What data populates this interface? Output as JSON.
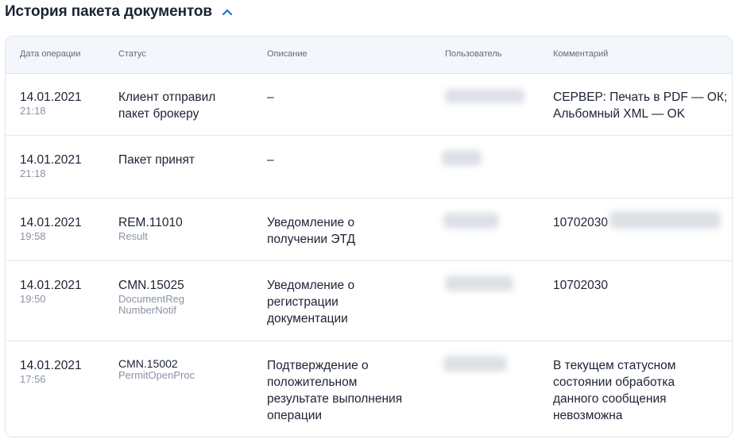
{
  "section": {
    "title": "История пакета документов",
    "expanded_icon": "chevron-up-icon"
  },
  "table": {
    "headers": [
      "Дата операции",
      "Статус",
      "Описание",
      "Пользователь",
      "Комментарий"
    ],
    "rows": [
      {
        "date": "14.01.2021",
        "time": "21:18",
        "status_main": "Клиент отправил пакет брокеру",
        "status_sub": "",
        "description": "–",
        "user": "",
        "comment": "СЕРВЕР: Печать в PDF — ОК; Альбомный XML — OK"
      },
      {
        "date": "14.01.2021",
        "time": "21:18",
        "status_main": "Пакет принят",
        "status_sub": "",
        "description": "–",
        "user": "",
        "comment": ""
      },
      {
        "date": "14.01.2021",
        "time": "19:58",
        "status_main": "REM.11010",
        "status_sub": "Result",
        "description": "Уведомление о получении ЭТД",
        "user": "",
        "comment": "10702030"
      },
      {
        "date": "14.01.2021",
        "time": "19:50",
        "status_main": "CMN.15025",
        "status_sub": "DocumentReg NumberNotif",
        "description": "Уведомление о регистрации документации",
        "user": "",
        "comment": "10702030"
      },
      {
        "date": "14.01.2021",
        "time": "17:56",
        "status_main": "CMN.15002",
        "status_sub": "PermitOpenProc",
        "description": "Подтверждение о положительном результате выполнения операции",
        "user": "",
        "comment": "В текущем статусном состоянии обработка данного сообщения невозможна"
      }
    ]
  },
  "colors": {
    "text": "#1b2333",
    "muted": "#8a93a3",
    "header_bg": "#f3f6fa",
    "accent": "#1f6fd6",
    "border": "#dfe5ee"
  }
}
